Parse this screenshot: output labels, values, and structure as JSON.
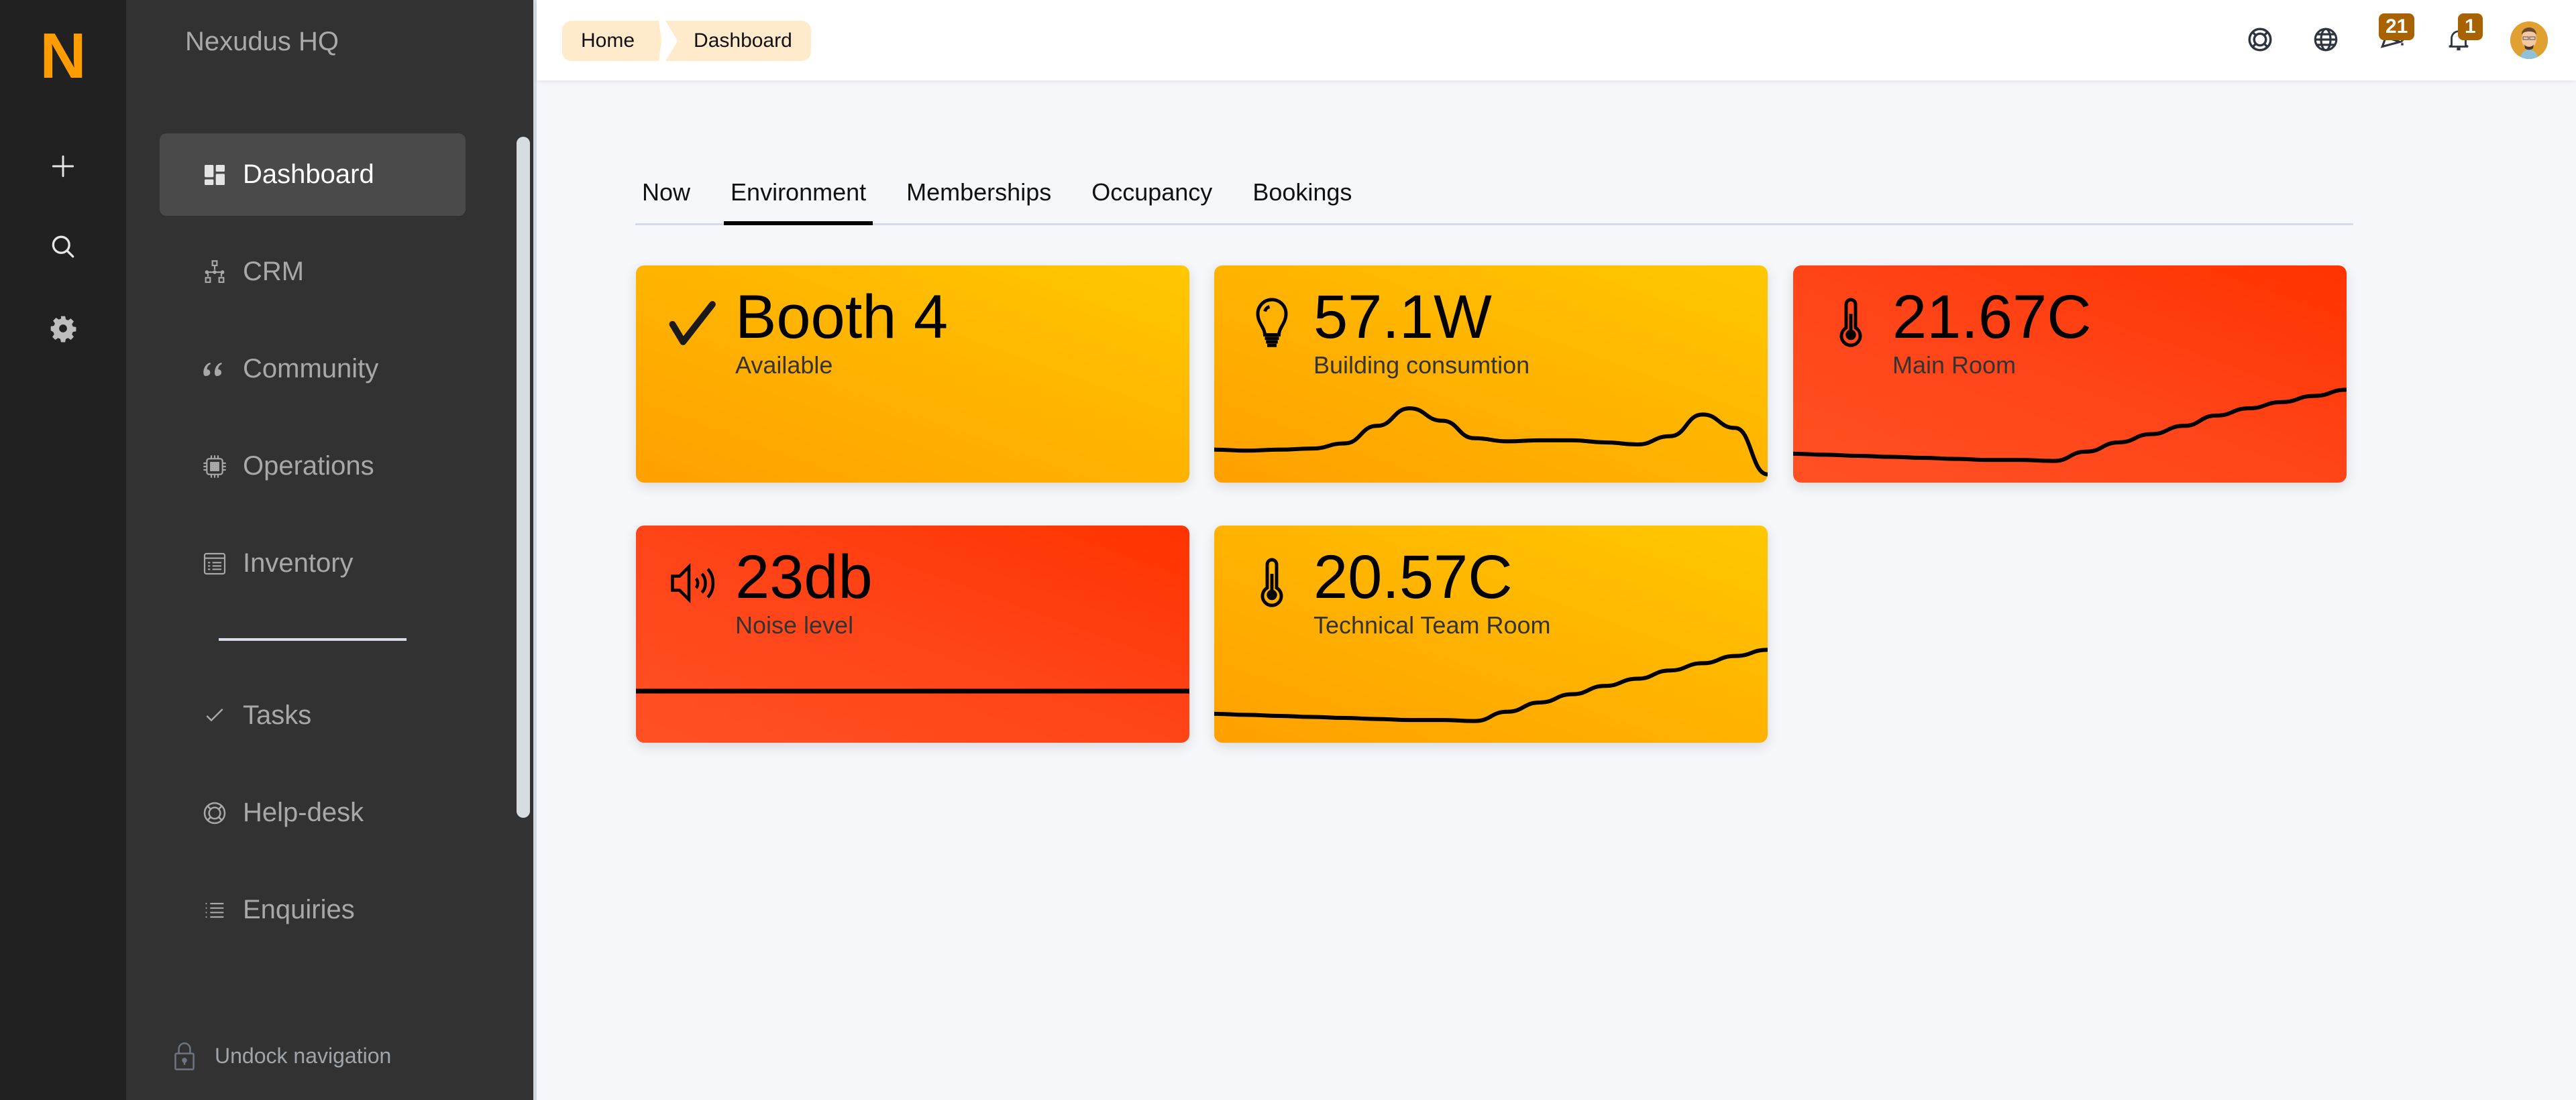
{
  "rail": {
    "logo": "N",
    "buttons": [
      {
        "name": "add",
        "icon": "plus-icon"
      },
      {
        "name": "search",
        "icon": "search-icon"
      },
      {
        "name": "settings",
        "icon": "gear-icon"
      }
    ]
  },
  "nav": {
    "org_name": "Nexudus HQ",
    "items": [
      {
        "label": "Dashboard",
        "icon": "dashboard-icon",
        "active": true
      },
      {
        "label": "CRM",
        "icon": "org-chart-icon",
        "active": false
      },
      {
        "label": "Community",
        "icon": "quote-icon",
        "active": false
      },
      {
        "label": "Operations",
        "icon": "chip-icon",
        "active": false
      },
      {
        "label": "Inventory",
        "icon": "list-box-icon",
        "active": false
      },
      {
        "label": "Tasks",
        "icon": "check-icon",
        "active": false
      },
      {
        "label": "Help-desk",
        "icon": "lifebuoy-icon",
        "active": false
      },
      {
        "label": "Enquiries",
        "icon": "list-icon",
        "active": false
      }
    ],
    "undock_label": "Undock navigation"
  },
  "header": {
    "breadcrumb": [
      "Home",
      "Dashboard"
    ],
    "icons": [
      {
        "name": "help",
        "icon": "lifebuoy-icon"
      },
      {
        "name": "language",
        "icon": "globe-icon"
      },
      {
        "name": "announcements",
        "icon": "megaphone-icon",
        "badge": "21"
      },
      {
        "name": "notifications",
        "icon": "bell-icon",
        "badge": "1"
      }
    ],
    "badge_color": "#a86300"
  },
  "tabs": [
    {
      "label": "Now",
      "active": false
    },
    {
      "label": "Environment",
      "active": true
    },
    {
      "label": "Memberships",
      "active": false
    },
    {
      "label": "Occupancy",
      "active": false
    },
    {
      "label": "Bookings",
      "active": false
    }
  ],
  "colors": {
    "accent": "#ff9d00",
    "card_yellow": "#ffb300",
    "card_red": "#ff4418"
  },
  "cards": [
    {
      "value": "Booth 4",
      "label": "Available",
      "icon": "checkmark-icon",
      "color": "yellow",
      "trend": []
    },
    {
      "value": "57.1W",
      "label": "Building consumtion",
      "icon": "lightbulb-icon",
      "color": "yellow",
      "trend": [
        0.32,
        0.31,
        0.32,
        0.33,
        0.38,
        0.55,
        0.72,
        0.6,
        0.43,
        0.4,
        0.41,
        0.41,
        0.39,
        0.37,
        0.45,
        0.66,
        0.53,
        0.08
      ]
    },
    {
      "value": "21.67C",
      "label": "Main Room",
      "icon": "thermometer-icon",
      "color": "red",
      "trend": [
        0.28,
        0.27,
        0.26,
        0.25,
        0.24,
        0.23,
        0.22,
        0.22,
        0.21,
        0.3,
        0.39,
        0.47,
        0.55,
        0.65,
        0.72,
        0.78,
        0.84,
        0.9
      ]
    },
    {
      "value": "23db",
      "label": "Noise level",
      "icon": "speaker-icon",
      "color": "red",
      "trend": [
        0.5,
        0.5,
        0.5,
        0.5,
        0.5,
        0.5,
        0.5,
        0.5,
        0.5,
        0.5
      ]
    },
    {
      "value": "20.57C",
      "label": "Technical Team Room",
      "icon": "thermometer-icon",
      "color": "yellow",
      "trend": [
        0.28,
        0.27,
        0.26,
        0.25,
        0.24,
        0.23,
        0.22,
        0.22,
        0.21,
        0.3,
        0.39,
        0.47,
        0.55,
        0.62,
        0.7,
        0.77,
        0.84,
        0.9
      ]
    }
  ]
}
